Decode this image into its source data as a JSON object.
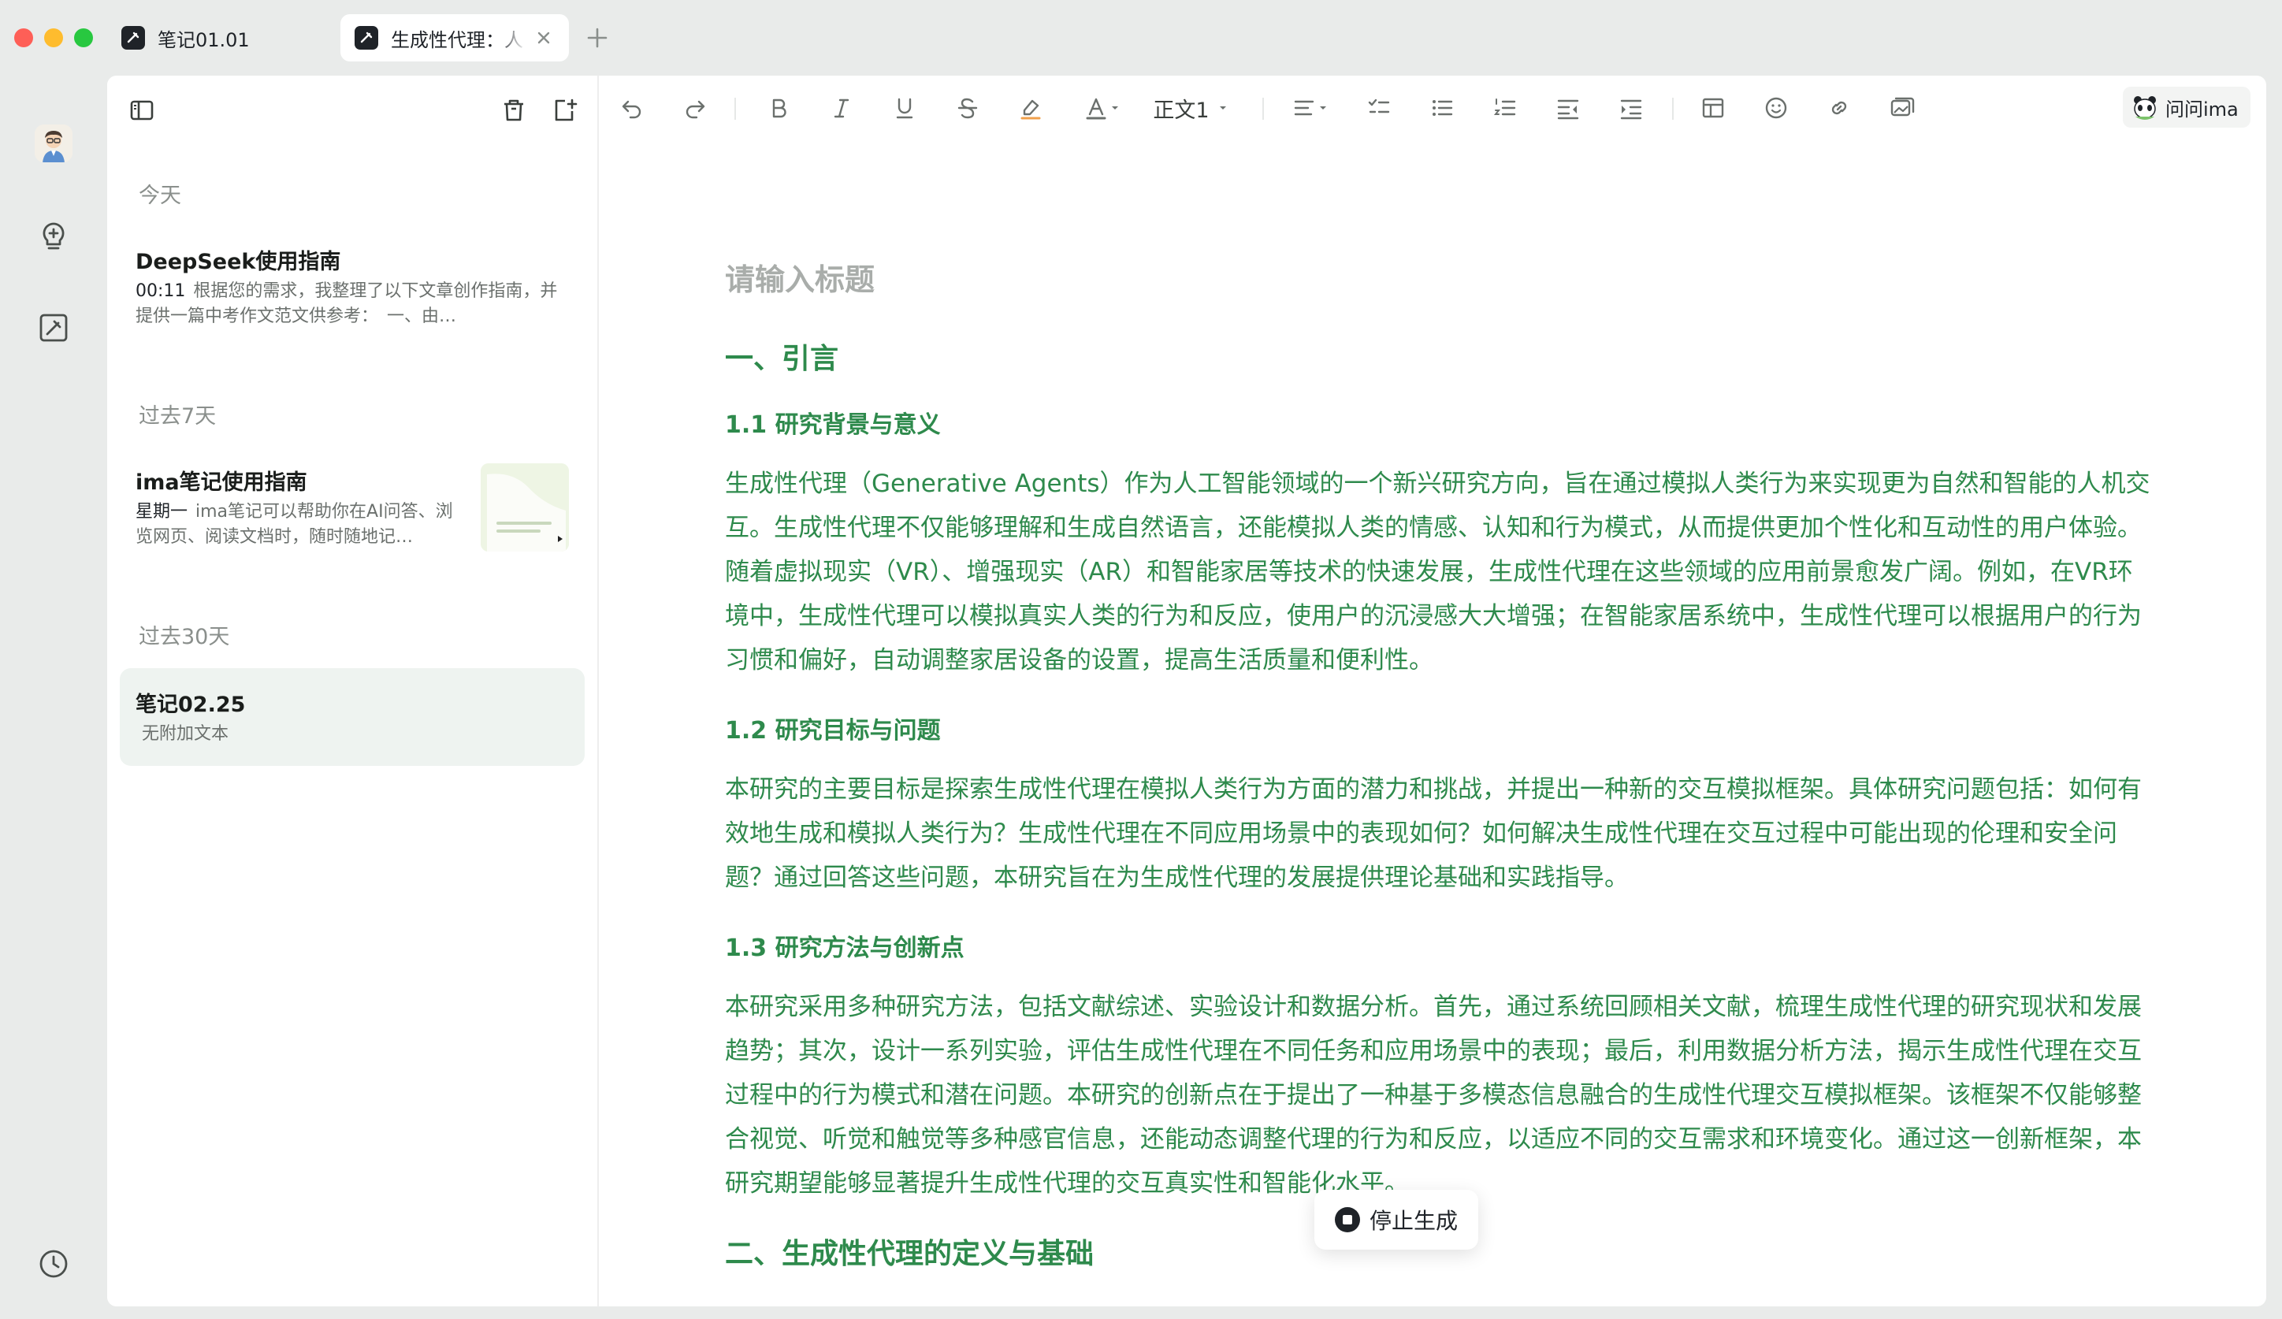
{
  "window": {
    "tabs": [
      {
        "label": "笔记01.01",
        "active": false
      },
      {
        "label": "生成性代理：人",
        "active": true
      }
    ]
  },
  "rail": {
    "icons": [
      "avatar",
      "lightbulb-plus-icon",
      "note-edit-icon",
      "history-clock-icon"
    ]
  },
  "sidebar": {
    "sections": [
      {
        "header": "今天",
        "notes": [
          {
            "title": "DeepSeek使用指南",
            "time": "00:11",
            "snippet": "根据您的需求，我整理了以下文章创作指南，并提供一篇中考作文范文供参考：　一、由…"
          }
        ]
      },
      {
        "header": "过去7天",
        "notes": [
          {
            "title": "ima笔记使用指南",
            "time": "星期一",
            "snippet": "ima笔记可以帮助你在AI问答、浏览网页、阅读文档时，随时随地记…",
            "has_thumbnail": true
          }
        ]
      },
      {
        "header": "过去30天",
        "notes": [
          {
            "title": "笔记02.25",
            "snippet": "无附加文本",
            "selected": true
          }
        ]
      }
    ]
  },
  "toolbar": {
    "text_style": "正文1",
    "ask_ima": "问问ima"
  },
  "document": {
    "title_placeholder": "请输入标题",
    "blocks": [
      {
        "type": "h1",
        "text": "一、引言"
      },
      {
        "type": "h2",
        "text": "1.1 研究背景与意义"
      },
      {
        "type": "p",
        "text": "生成性代理（Generative Agents）作为人工智能领域的一个新兴研究方向，旨在通过模拟人类行为来实现更为自然和智能的人机交互。生成性代理不仅能够理解和生成自然语言，还能模拟人类的情感、认知和行为模式，从而提供更加个性化和互动性的用户体验。随着虚拟现实（VR）、增强现实（AR）和智能家居等技术的快速发展，生成性代理在这些领域的应用前景愈发广阔。例如，在VR环境中，生成性代理可以模拟真实人类的行为和反应，使用户的沉浸感大大增强；在智能家居系统中，生成性代理可以根据用户的行为习惯和偏好，自动调整家居设备的设置，提高生活质量和便利性。"
      },
      {
        "type": "h2",
        "text": "1.2 研究目标与问题"
      },
      {
        "type": "p",
        "text": "本研究的主要目标是探索生成性代理在模拟人类行为方面的潜力和挑战，并提出一种新的交互模拟框架。具体研究问题包括：如何有效地生成和模拟人类行为？生成性代理在不同应用场景中的表现如何？如何解决生成性代理在交互过程中可能出现的伦理和安全问题？通过回答这些问题，本研究旨在为生成性代理的发展提供理论基础和实践指导。"
      },
      {
        "type": "h2",
        "text": "1.3 研究方法与创新点"
      },
      {
        "type": "p",
        "text": "本研究采用多种研究方法，包括文献综述、实验设计和数据分析。首先，通过系统回顾相关文献，梳理生成性代理的研究现状和发展趋势；其次，设计一系列实验，评估生成性代理在不同任务和应用场景中的表现；最后，利用数据分析方法，揭示生成性代理在交互过程中的行为模式和潜在问题。本研究的创新点在于提出了一种基于多模态信息融合的生成性代理交互模拟框架。该框架不仅能够整合视觉、听觉和触觉等多种感官信息，还能动态调整代理的行为和反应，以适应不同的交互需求和环境变化。通过这一创新框架，本研究期望能够显著提升生成性代理的交互真实性和智能化水平。"
      },
      {
        "type": "h1",
        "text": "二、生成性代理的定义与基础"
      }
    ]
  },
  "generation": {
    "stop_label": "停止生成"
  },
  "colors": {
    "accent_green": "#2e8a4c",
    "selected_bg": "#eef3f0",
    "title_placeholder": "#a9adaa"
  }
}
